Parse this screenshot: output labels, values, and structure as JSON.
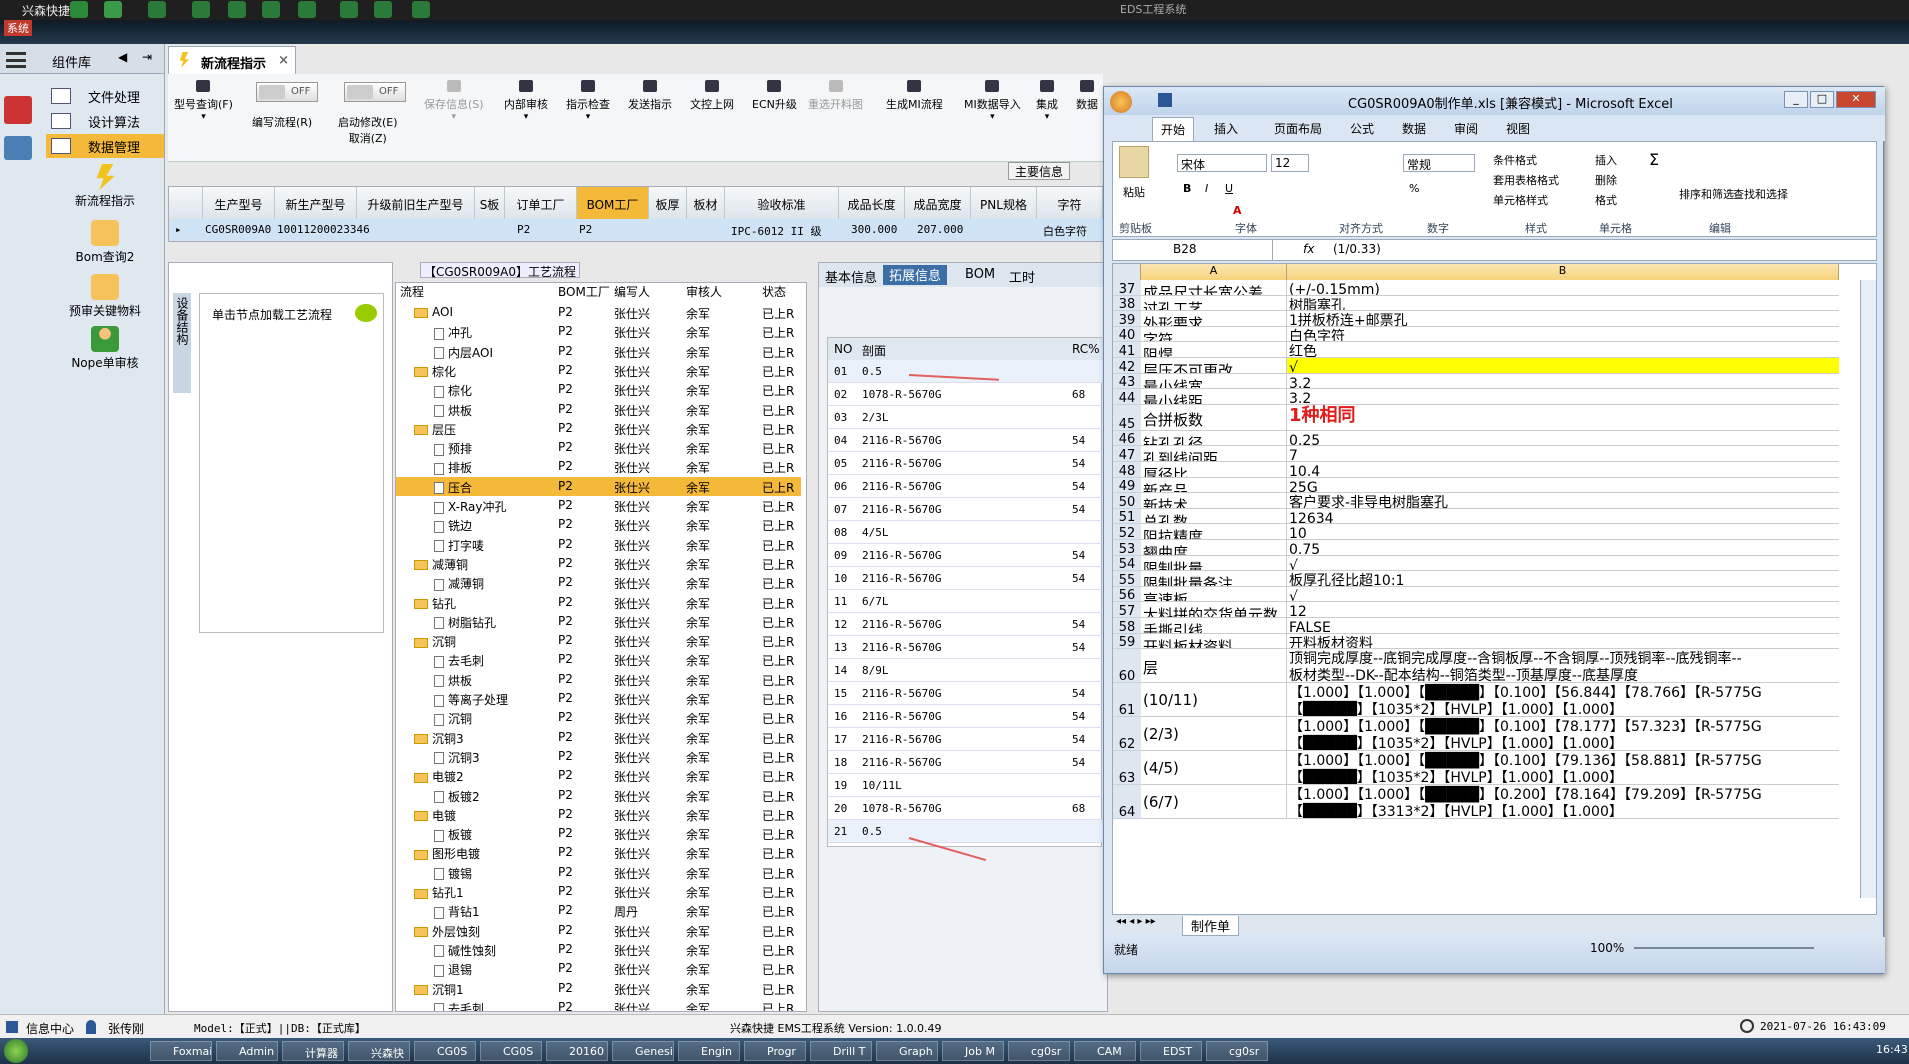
{
  "topbar": {
    "title": "兴森快捷",
    "app_title": "EDS工程系统",
    "sys": "系统"
  },
  "sidebar": {
    "header": "组件库",
    "items": [
      {
        "label": "文件处理"
      },
      {
        "label": "设计算法"
      },
      {
        "label": "数据管理"
      }
    ],
    "buttons": [
      "新流程指示",
      "Bom查询2",
      "预审关键物料",
      "Nope单审核"
    ]
  },
  "tab": {
    "label": "新流程指示"
  },
  "toolbar": {
    "items": [
      "型号查询(F)",
      "编写流程(R)",
      "启动修改(E)",
      "保存信息(S)",
      "内部审核",
      "指示检查",
      "发送指示",
      "文控上网",
      "ECN升级",
      "重选开料图",
      "生成MI流程",
      "MI数据导入",
      "集成",
      "数据"
    ],
    "cancel": "取消(Z)",
    "toggle_off": "OFF"
  },
  "main_info_label": "主要信息",
  "grid1": {
    "headers": [
      "生产型号",
      "新生产型号",
      "升级前旧生产型号",
      "S板",
      "订单工厂",
      "BOM工厂",
      "板厚",
      "板材",
      "验收标准",
      "成品长度",
      "成品宽度",
      "PNL规格",
      "字符"
    ],
    "row": [
      "CG0SR009A0",
      "10011200023346",
      "P2",
      "P2",
      "IPC-6012 II 级",
      "300.000",
      "207.000",
      "白色字符"
    ]
  },
  "left_panel": {
    "vtab": "设备结构",
    "node_text": "单击节点加载工艺流程"
  },
  "flow_caption": "【CG0SR009A0】工艺流程",
  "tree": {
    "headers": [
      "流程",
      "BOM工厂",
      "编写人",
      "审核人",
      "状态"
    ],
    "rows": [
      {
        "t": "AOI",
        "f": true,
        "d": 0
      },
      {
        "t": "冲孔",
        "f": false,
        "d": 1
      },
      {
        "t": "内层AOI",
        "f": false,
        "d": 1
      },
      {
        "t": "棕化",
        "f": true,
        "d": 0
      },
      {
        "t": "棕化",
        "f": false,
        "d": 1
      },
      {
        "t": "烘板",
        "f": false,
        "d": 1
      },
      {
        "t": "层压",
        "f": true,
        "d": 0
      },
      {
        "t": "预排",
        "f": false,
        "d": 1
      },
      {
        "t": "排板",
        "f": false,
        "d": 1
      },
      {
        "t": "压合",
        "f": false,
        "d": 1,
        "sel": true
      },
      {
        "t": "X-Ray冲孔",
        "f": false,
        "d": 1
      },
      {
        "t": "铣边",
        "f": false,
        "d": 1
      },
      {
        "t": "打字唛",
        "f": false,
        "d": 1
      },
      {
        "t": "减薄铜",
        "f": true,
        "d": 0
      },
      {
        "t": "减薄铜",
        "f": false,
        "d": 1
      },
      {
        "t": "钻孔",
        "f": true,
        "d": 0
      },
      {
        "t": "树脂钻孔",
        "f": false,
        "d": 1
      },
      {
        "t": "沉铜",
        "f": true,
        "d": 0
      },
      {
        "t": "去毛刺",
        "f": false,
        "d": 1
      },
      {
        "t": "烘板",
        "f": false,
        "d": 1
      },
      {
        "t": "等离子处理",
        "f": false,
        "d": 1
      },
      {
        "t": "沉铜",
        "f": false,
        "d": 1
      },
      {
        "t": "沉铜3",
        "f": true,
        "d": 0
      },
      {
        "t": "沉铜3",
        "f": false,
        "d": 1
      },
      {
        "t": "电镀2",
        "f": true,
        "d": 0
      },
      {
        "t": "板镀2",
        "f": false,
        "d": 1
      },
      {
        "t": "电镀",
        "f": true,
        "d": 0
      },
      {
        "t": "板镀",
        "f": false,
        "d": 1
      },
      {
        "t": "图形电镀",
        "f": true,
        "d": 0
      },
      {
        "t": "镀锡",
        "f": false,
        "d": 1
      },
      {
        "t": "钻孔1",
        "f": true,
        "d": 0
      },
      {
        "t": "背钻1",
        "f": false,
        "d": 1,
        "w": "周丹"
      },
      {
        "t": "外层蚀刻",
        "f": true,
        "d": 0
      },
      {
        "t": "碱性蚀刻",
        "f": false,
        "d": 1
      },
      {
        "t": "退锡",
        "f": false,
        "d": 1
      },
      {
        "t": "沉铜1",
        "f": true,
        "d": 0
      },
      {
        "t": "去毛刺",
        "f": false,
        "d": 1
      }
    ],
    "bom": "P2",
    "writer": "张仕兴",
    "reviewer": "余军",
    "status": "已上R"
  },
  "right_panel": {
    "tabs": [
      "基本信息",
      "拓展信息",
      "BOM",
      "工时"
    ],
    "headers": [
      "NO",
      "剖面",
      "RC%"
    ],
    "rows": [
      [
        "01",
        "0.5",
        ""
      ],
      [
        "02",
        "1078-R-5670G",
        "68"
      ],
      [
        "03",
        "2/3L",
        ""
      ],
      [
        "04",
        "2116-R-5670G",
        "54"
      ],
      [
        "05",
        "2116-R-5670G",
        "54"
      ],
      [
        "06",
        "2116-R-5670G",
        "54"
      ],
      [
        "07",
        "2116-R-5670G",
        "54"
      ],
      [
        "08",
        "4/5L",
        ""
      ],
      [
        "09",
        "2116-R-5670G",
        "54"
      ],
      [
        "10",
        "2116-R-5670G",
        "54"
      ],
      [
        "11",
        "6/7L",
        ""
      ],
      [
        "12",
        "2116-R-5670G",
        "54"
      ],
      [
        "13",
        "2116-R-5670G",
        "54"
      ],
      [
        "14",
        "8/9L",
        ""
      ],
      [
        "15",
        "2116-R-5670G",
        "54"
      ],
      [
        "16",
        "2116-R-5670G",
        "54"
      ],
      [
        "17",
        "2116-R-5670G",
        "54"
      ],
      [
        "18",
        "2116-R-5670G",
        "54"
      ],
      [
        "19",
        "10/11L",
        ""
      ],
      [
        "20",
        "1078-R-5670G",
        "68"
      ],
      [
        "21",
        "0.5",
        ""
      ]
    ]
  },
  "excel": {
    "title": "CG0SR009A0制作单.xls  [兼容模式] - Microsoft Excel",
    "tabs": [
      "开始",
      "插入",
      "页面布局",
      "公式",
      "数据",
      "审阅",
      "视图"
    ],
    "font": "宋体",
    "size": "12",
    "numfmt": "常规",
    "groups": [
      "剪贴板",
      "字体",
      "对齐方式",
      "数字",
      "样式",
      "单元格",
      "编辑"
    ],
    "ribbon_btns": [
      "粘贴",
      "条件格式",
      "套用表格格式",
      "单元格样式",
      "插入",
      "删除",
      "格式",
      "排序和筛选",
      "查找和选择"
    ],
    "namebox": "B28",
    "formula": "(1/0.33)",
    "cols": [
      "A",
      "B"
    ],
    "rows": [
      {
        "n": "37",
        "a": "成品尺寸长宽公差",
        "b": "(+/-0.15mm)"
      },
      {
        "n": "38",
        "a": "过孔工艺",
        "b": "树脂塞孔"
      },
      {
        "n": "39",
        "a": "外形要求",
        "b": "1拼板桥连+邮票孔"
      },
      {
        "n": "40",
        "a": "字符",
        "b": "白色字符"
      },
      {
        "n": "41",
        "a": "阻焊",
        "b": "红色"
      },
      {
        "n": "42",
        "a": "层压不可更改",
        "b": "√",
        "yellow": true
      },
      {
        "n": "43",
        "a": "最小线宽",
        "b": "3.2"
      },
      {
        "n": "44",
        "a": "最小线距",
        "b": "3.2"
      },
      {
        "n": "45",
        "a": "合拼板数",
        "b": "1种相同",
        "red": true,
        "h": 26
      },
      {
        "n": "46",
        "a": "钻孔孔径",
        "b": "0.25"
      },
      {
        "n": "47",
        "a": "孔到线间距",
        "b": "7"
      },
      {
        "n": "48",
        "a": "厚径比",
        "b": "10.4"
      },
      {
        "n": "49",
        "a": "新产品",
        "b": "25G"
      },
      {
        "n": "50",
        "a": "新技术",
        "b": "客户要求-非导电树脂塞孔"
      },
      {
        "n": "51",
        "a": "总孔数",
        "b": "12634"
      },
      {
        "n": "52",
        "a": "阻抗精度",
        "b": "10"
      },
      {
        "n": "53",
        "a": "翘曲度",
        "b": "0.75"
      },
      {
        "n": "54",
        "a": "限制批量",
        "b": "√"
      },
      {
        "n": "55",
        "a": "限制批量备注",
        "b": "板厚孔径比超10:1"
      },
      {
        "n": "56",
        "a": "高速板",
        "b": "√"
      },
      {
        "n": "57",
        "a": "大料拼的交货单元数",
        "b": "12"
      },
      {
        "n": "58",
        "a": "手撕引线",
        "b": "FALSE"
      },
      {
        "n": "59",
        "a": "开料板材资料",
        "b": "开料板材资料"
      },
      {
        "n": "60",
        "a": "层",
        "b": "顶铜完成厚度--底铜完成厚度--含铜板厚--不含铜厚--顶残铜率--底残铜率--\n板材类型--DK--配本结构--铜箔类型--顶基厚度--底基厚度",
        "h": 34
      },
      {
        "n": "61",
        "a": "(10/11)",
        "b": "【1.000】【1.000】【█████】【0.100】【56.844】【78.766】【R-5775G\n【█████】【1035*2】【HVLP】【1.000】【1.000】",
        "h": 34
      },
      {
        "n": "62",
        "a": "(2/3)",
        "b": "【1.000】【1.000】【█████】【0.100】【78.177】【57.323】【R-5775G\n【█████】【1035*2】【HVLP】【1.000】【1.000】",
        "h": 34
      },
      {
        "n": "63",
        "a": "(4/5)",
        "b": "【1.000】【1.000】【█████】【0.100】【79.136】【58.881】【R-5775G\n【█████】【1035*2】【HVLP】【1.000】【1.000】",
        "h": 34
      },
      {
        "n": "64",
        "a": "(6/7)",
        "b": "【1.000】【1.000】【█████】【0.200】【78.164】【79.209】【R-5775G\n【█████】【3313*2】【HVLP】【1.000】【1.000】",
        "h": 34
      }
    ],
    "sheet_tab": "制作单",
    "status": "就绪",
    "zoom": "100%"
  },
  "status": {
    "info": "信息中心",
    "user": "张传刚",
    "model": "Model:【正式】||DB:【正式库】",
    "version": "兴森快捷  EMS工程系统  Version: 1.0.0.49",
    "datetime": "2021-07-26  16:43:09"
  },
  "taskbar": [
    "Foxmail",
    "Admin",
    "计算器",
    "兴森快",
    "CG0S",
    "CG0S",
    "20160",
    "Genesis",
    "Engin",
    "Progr",
    "Drill T",
    "Graph",
    "Job M",
    "cg0sr",
    "CAM",
    "EDST",
    "cg0sr"
  ],
  "taskbar_time": "16:43"
}
